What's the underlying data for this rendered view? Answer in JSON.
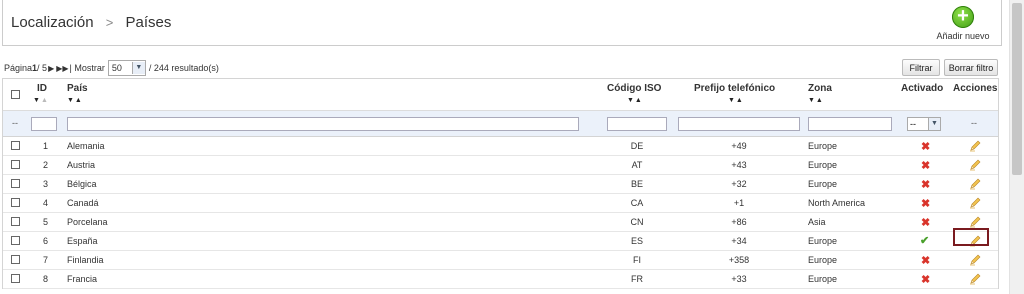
{
  "breadcrumb": {
    "parent": "Localización",
    "separator": ">",
    "current": "Países"
  },
  "add_button": {
    "label": "Añadir nuevo"
  },
  "pager": {
    "page_prefix": "Página ",
    "page_current": "1",
    "page_sep": " / 5",
    "show_label": " | Mostrar ",
    "per_page": "50",
    "results": " / 244 resultado(s)"
  },
  "buttons": {
    "filter": "Filtrar",
    "reset": "Borrar filtro"
  },
  "columns": {
    "id": "ID",
    "country": "País",
    "iso": "Código ISO",
    "phone": "Prefijo telefónico",
    "zone": "Zona",
    "active": "Activado",
    "actions": "Acciones"
  },
  "filter_row": {
    "dash": "--",
    "active_value": "--",
    "actions_dash": "--"
  },
  "rows": [
    {
      "id": "1",
      "country": "Alemania",
      "iso": "DE",
      "phone": "+49",
      "zone": "Europe",
      "active": "no"
    },
    {
      "id": "2",
      "country": "Austria",
      "iso": "AT",
      "phone": "+43",
      "zone": "Europe",
      "active": "no"
    },
    {
      "id": "3",
      "country": "Bélgica",
      "iso": "BE",
      "phone": "+32",
      "zone": "Europe",
      "active": "no"
    },
    {
      "id": "4",
      "country": "Canadá",
      "iso": "CA",
      "phone": "+1",
      "zone": "North America",
      "active": "no"
    },
    {
      "id": "5",
      "country": "Porcelana",
      "iso": "CN",
      "phone": "+86",
      "zone": "Asia",
      "active": "no"
    },
    {
      "id": "6",
      "country": "España",
      "iso": "ES",
      "phone": "+34",
      "zone": "Europe",
      "active": "yes"
    },
    {
      "id": "7",
      "country": "Finlandia",
      "iso": "FI",
      "phone": "+358",
      "zone": "Europe",
      "active": "no"
    },
    {
      "id": "8",
      "country": "Francia",
      "iso": "FR",
      "phone": "+33",
      "zone": "Europe",
      "active": "no"
    }
  ],
  "icons": {
    "inactive": "x-icon",
    "active": "check-icon",
    "edit": "pencil-icon",
    "add": "plus-circle-icon"
  },
  "colors": {
    "inactive": "#d9342b",
    "active": "#4aa02c",
    "highlight": "#7a1a1f",
    "filter_bg": "#ebf1fa"
  }
}
